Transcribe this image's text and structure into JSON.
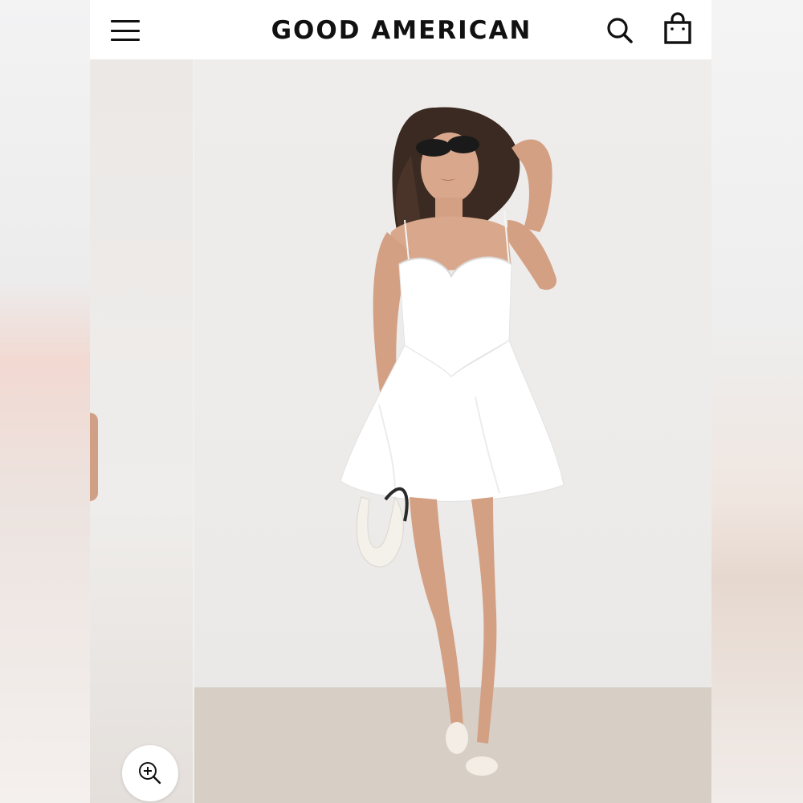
{
  "header": {
    "brand": "GOOD AMERICAN",
    "menu_icon": "hamburger-menu-icon",
    "search_icon": "search-icon",
    "bag_icon": "shopping-bag-icon"
  },
  "gallery": {
    "zoom_icon": "zoom-in-icon",
    "main_image": "model-white-mini-dress-photo",
    "prev_image": "previous-product-photo-edge"
  },
  "colors": {
    "text": "#111111",
    "header_bg": "#ffffff",
    "dress": "#ffffff",
    "skin": "#d9a88c",
    "hair": "#3a2a22",
    "floor": "#d7cec6",
    "wall": "#ecebe9"
  }
}
